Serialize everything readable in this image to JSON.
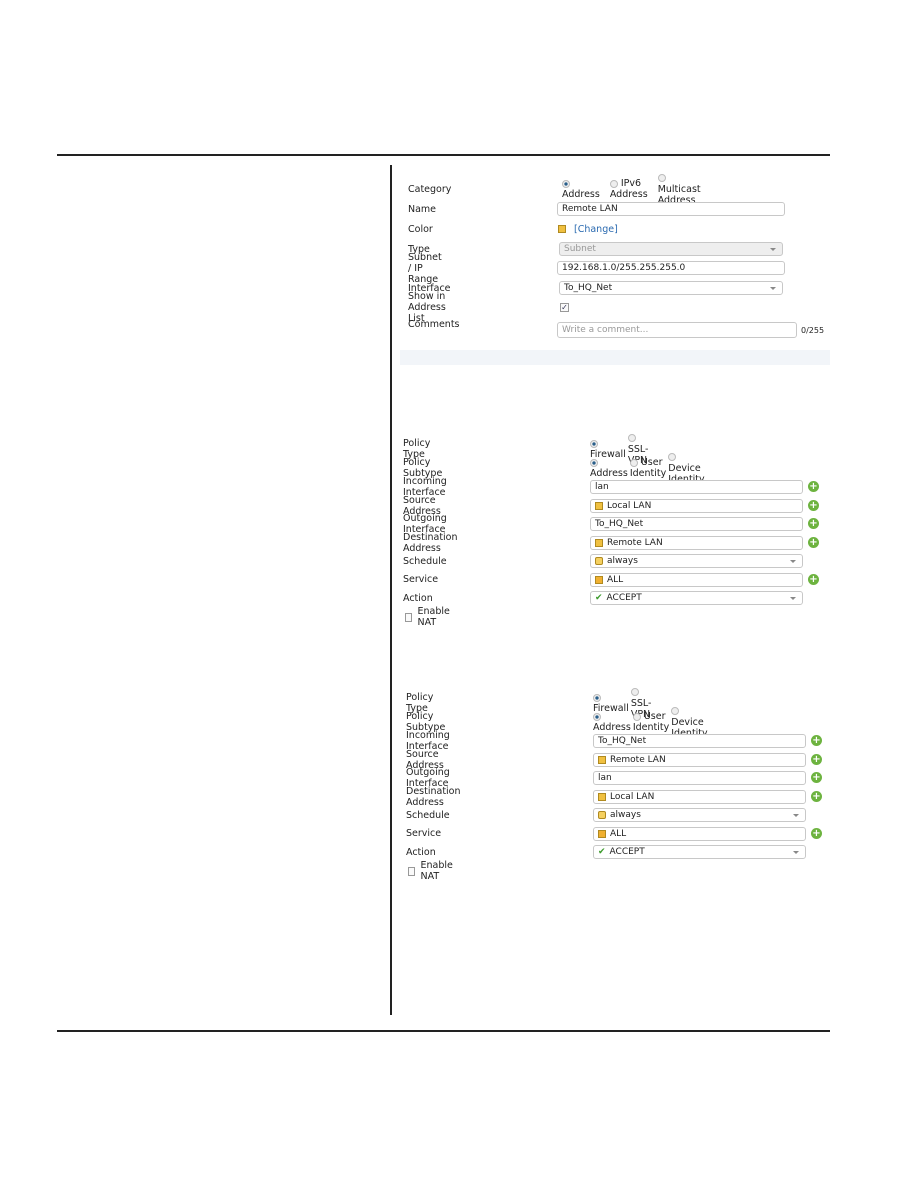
{
  "address_form": {
    "category_label": "Category",
    "category_options": [
      "Address",
      "IPv6 Address",
      "Multicast Address"
    ],
    "category_selected": "Address",
    "name_label": "Name",
    "name_value": "Remote LAN",
    "color_label": "Color",
    "color_change": "[Change]",
    "type_label": "Type",
    "type_value": "Subnet",
    "subnet_label": "Subnet / IP Range",
    "subnet_value": "192.168.1.0/255.255.255.0",
    "interface_label": "Interface",
    "interface_value": "To_HQ_Net",
    "show_label": "Show in Address List",
    "show_checked": true,
    "comments_label": "Comments",
    "comments_placeholder": "Write a comment...",
    "comments_count": "0/255"
  },
  "policies": [
    {
      "policy_type_label": "Policy Type",
      "policy_types": [
        "Firewall",
        "SSL-VPN"
      ],
      "subtype_label": "Policy Subtype",
      "subtypes": [
        "Address",
        "User Identity",
        "Device Identity"
      ],
      "incoming_label": "Incoming Interface",
      "incoming": "lan",
      "source_label": "Source Address",
      "source": "Local LAN",
      "outgoing_label": "Outgoing Interface",
      "outgoing": "To_HQ_Net",
      "dest_label": "Destination Address",
      "dest": "Remote LAN",
      "schedule_label": "Schedule",
      "schedule": "always",
      "service_label": "Service",
      "service": "ALL",
      "action_label": "Action",
      "action": "ACCEPT",
      "nat_label": "Enable NAT",
      "nat_checked": false
    },
    {
      "policy_type_label": "Policy Type",
      "policy_types": [
        "Firewall",
        "SSL-VPN"
      ],
      "subtype_label": "Policy Subtype",
      "subtypes": [
        "Address",
        "User Identity",
        "Device Identity"
      ],
      "incoming_label": "Incoming Interface",
      "incoming": "To_HQ_Net",
      "source_label": "Source Address",
      "source": "Remote LAN",
      "outgoing_label": "Outgoing Interface",
      "outgoing": "lan",
      "dest_label": "Destination Address",
      "dest": "Local LAN",
      "schedule_label": "Schedule",
      "schedule": "always",
      "service_label": "Service",
      "service": "ALL",
      "action_label": "Action",
      "action": "ACCEPT",
      "nat_label": "Enable NAT",
      "nat_checked": false
    }
  ],
  "colors": {
    "plus": "#6db33f",
    "link": "#2a6ab0",
    "address_icon": "#f0c040"
  }
}
